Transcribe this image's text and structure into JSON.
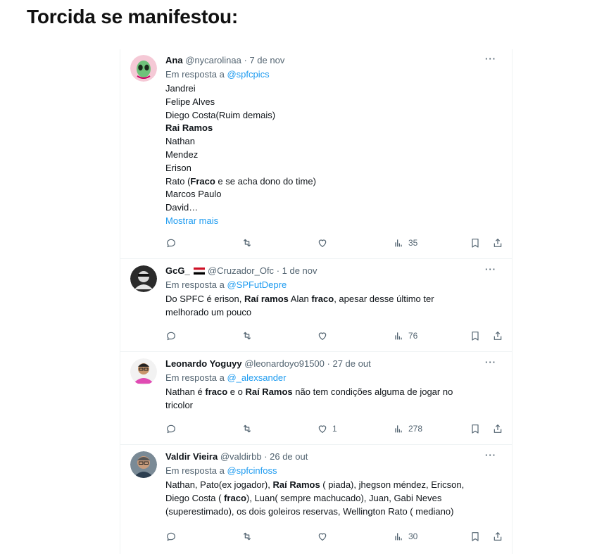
{
  "headline": "Torcida se manifestou:",
  "tweets": [
    {
      "name": "Ana",
      "handle": "@nycarolinaa",
      "date": "· 7 de nov",
      "reply_prefix": "Em resposta a",
      "reply_to": "@spfcpics",
      "lines": [
        "Jandrei",
        "Felipe Alves",
        "Diego Costa(Ruim demais)",
        "Rai Ramos",
        "Nathan",
        "Mendez",
        "Erison",
        "Rato (Fraco e se acha dono do time)",
        "Marcos Paulo",
        "David…"
      ],
      "show_more": "Mostrar mais",
      "views": "35",
      "likes": ""
    },
    {
      "name": "GcG_",
      "handle": "@Cruzador_Ofc",
      "date": "· 1 de nov",
      "reply_prefix": "Em resposta a",
      "reply_to": "@SPFutDepre",
      "lines": [
        "Do SPFC é erison, Raí ramos Alan fraco, apesar desse último ter",
        "melhorado um pouco"
      ],
      "views": "76",
      "likes": ""
    },
    {
      "name": "Leonardo Yoguyy",
      "handle": "@leonardoyo91500",
      "date": "· 27 de out",
      "reply_prefix": "Em resposta a",
      "reply_to": "@_alexsander",
      "lines": [
        "Nathan é fraco e o Raí Ramos não tem condições alguma de jogar no",
        "tricolor"
      ],
      "views": "278",
      "likes": "1"
    },
    {
      "name": "Valdir Vieira",
      "handle": "@valdirbb",
      "date": "· 26 de out",
      "reply_prefix": "Em resposta a",
      "reply_to": "@spfcinfoss",
      "lines": [
        "Nathan, Pato(ex jogador), Raí Ramos ( piada), jhegson méndez, Ericson,",
        "Diego Costa ( fraco), Luan( sempre machucado), Juan, Gabi Neves",
        "(superestimado), os dois goleiros reservas, Wellington Rato ( mediano)"
      ],
      "views": "30",
      "likes": ""
    }
  ],
  "more_glyph": "···",
  "icons": [
    "reply-icon",
    "retweet-icon",
    "like-icon",
    "views-icon",
    "bookmark-icon",
    "share-icon"
  ],
  "colors": {
    "link": "#1d9bf0",
    "muted": "#536471",
    "text": "#0f1419",
    "divider": "#eff3f4"
  }
}
